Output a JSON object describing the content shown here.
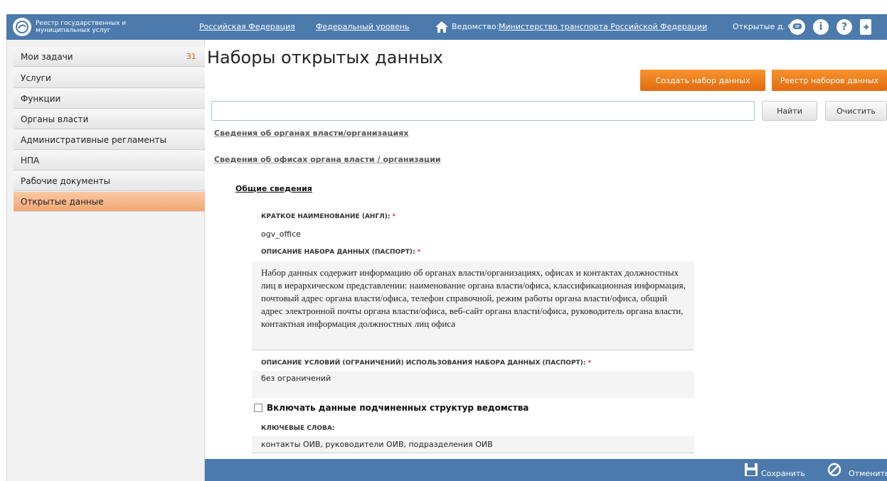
{
  "header": {
    "logo_text": "Реестр государственных и муниципальных услуг",
    "nav_region": "Российская Федерация",
    "nav_level": "Федеральный уровень",
    "vedomstvo_label": "Ведомство:",
    "vedomstvo_value": "Министерство транспорта Российской Федерации",
    "user_name": "Открытые д. Ф.",
    "icons": [
      "home-icon",
      "chat-icon",
      "info-icon",
      "help-icon",
      "exit-icon"
    ]
  },
  "sidebar": {
    "items": [
      {
        "label": "Мои задачи",
        "count": "31"
      },
      {
        "label": "Услуги"
      },
      {
        "label": "Функции"
      },
      {
        "label": "Органы власти"
      },
      {
        "label": "Административные регламенты"
      },
      {
        "label": "НПА"
      },
      {
        "label": "Рабочие документы"
      },
      {
        "label": "Открытые данные",
        "active": true
      }
    ]
  },
  "main": {
    "title": "Наборы открытых данных",
    "create_button": "Создать набор данных",
    "registry_button": "Реестр наборов данных",
    "search_value": "",
    "find_button": "Найти",
    "clear_button": "Очистить",
    "section_orgs": "Сведения об органах власти/организациях",
    "section_offices": "Сведения об офисах органа власти / организации",
    "general_heading": "Общие сведения",
    "short_name_label": "КРАТКОЕ НАИМЕНОВАНИЕ (АНГЛ):",
    "short_name_value": "ogv_office",
    "description_label": "ОПИСАНИЕ НАБОРА ДАННЫХ (ПАСПОРТ):",
    "description_value": "Набор данных содержит информацию об органах власти/организациях, офисах и контактах должностных лиц в иерархическом представлении: наименование органа власти/офиса, классификационная информация, почтовый адрес органа власти/офиса, телефон справочной, режим работы органа власти/офиса, общий адрес электронной почты органа власти/офиса, веб-сайт органа власти/офиса, руководитель органа власти, контактная информация должностных лиц офиса",
    "conditions_label": "ОПИСАНИЕ УСЛОВИЙ (ОГРАНИЧЕНИЙ) ИСПОЛЬЗОВАНИЯ НАБОРА ДАННЫХ (ПАСПОРТ):",
    "conditions_value": "без ограничений",
    "include_sub_label": "Включать данные подчиненных структур ведомства",
    "include_sub_checked": false,
    "keywords_label": "КЛЮЧЕВЫЕ СЛОВА:",
    "keywords_value": "контакты ОИВ, руководители ОИВ, подразделения ОИВ",
    "required_mark": "*"
  },
  "footer": {
    "save_label": "Сохранить",
    "cancel_label": "Отменить"
  },
  "colors": {
    "header_blue": "#4c7aad",
    "accent_orange": "#f08a24",
    "active_sidebar": "#f4b184"
  }
}
